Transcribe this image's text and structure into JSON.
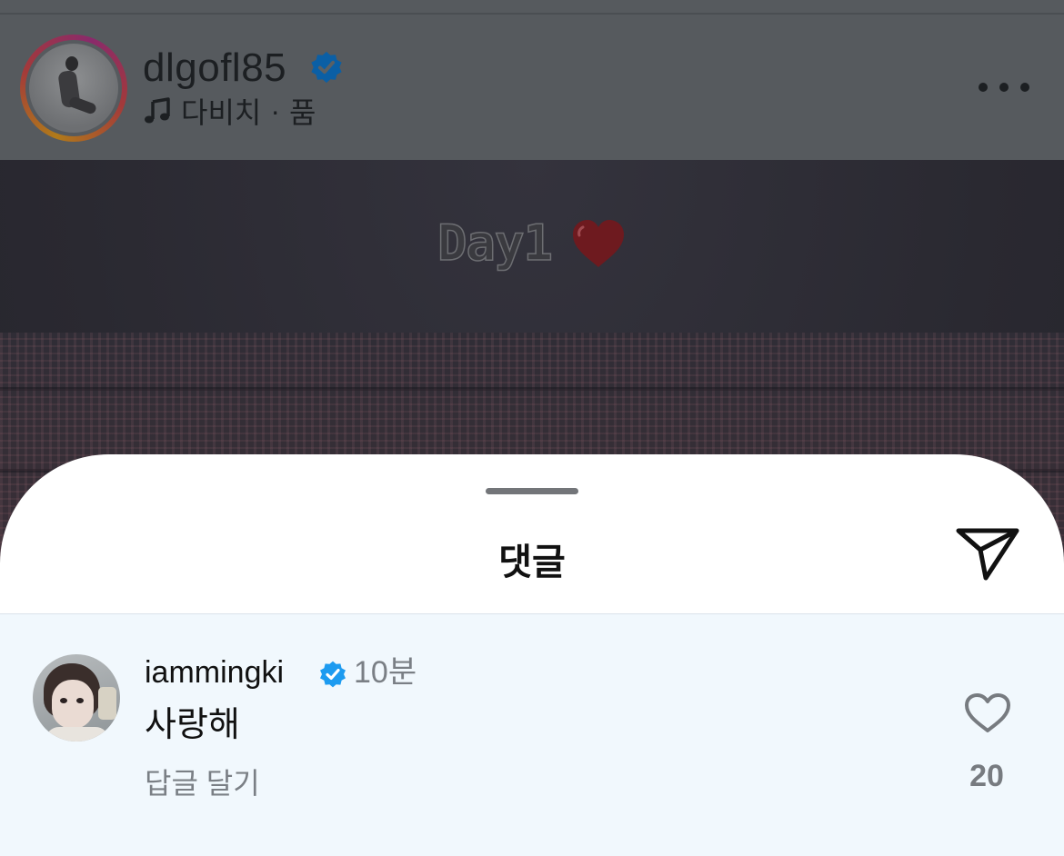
{
  "header": {
    "username": "dlgofl85",
    "verified": true,
    "music": {
      "icon": "music-note-icon",
      "artist": "다비치",
      "separator": "·",
      "song": "품"
    },
    "more_icon": "more-dots-icon"
  },
  "media": {
    "overlay_text": "Day1",
    "overlay_emoji": "heart-emoji"
  },
  "comments_sheet": {
    "title": "댓글",
    "send_icon": "send-icon",
    "comments": [
      {
        "username": "iammingki",
        "verified": true,
        "time": "10분",
        "text": "사랑해",
        "reply_label": "답글 달기",
        "like_count": "20"
      }
    ]
  },
  "colors": {
    "verified_blue": "#1d9bf0",
    "header_dim": "#565a5e",
    "comment_highlight": "#f1f8fd"
  }
}
